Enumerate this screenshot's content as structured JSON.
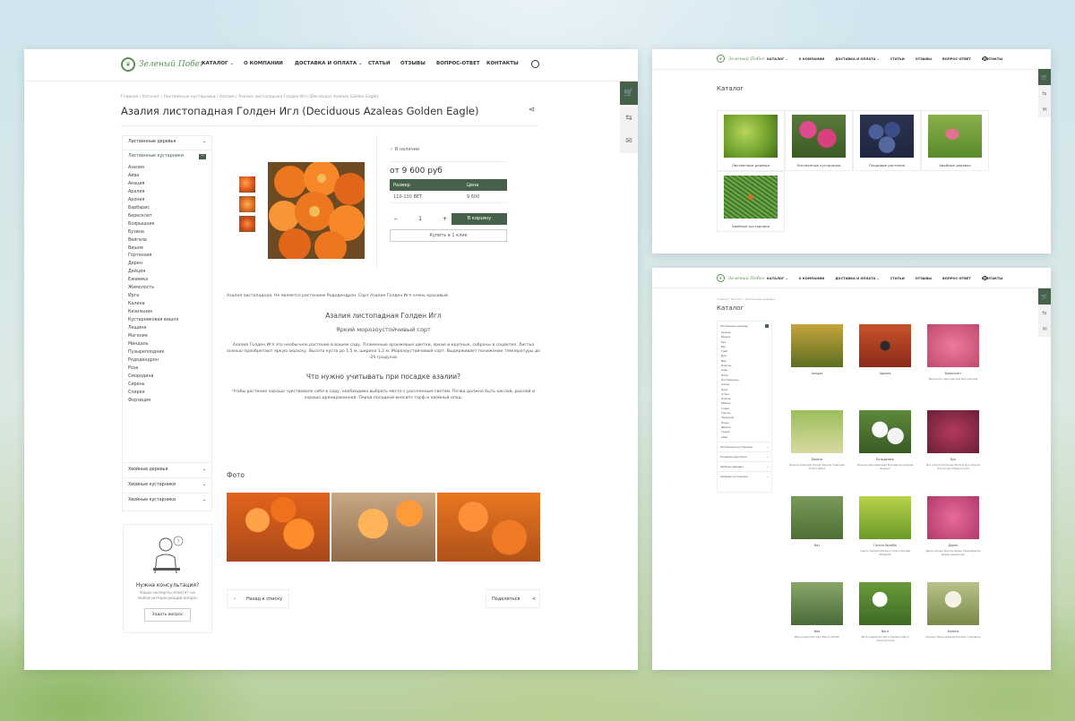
{
  "logo_text": "Зеленый Побег",
  "main": {
    "nav": [
      {
        "label": "КАТАЛОГ",
        "caret": "⌄"
      },
      {
        "label": "О КОМПАНИИ"
      },
      {
        "label": "ДОСТАВКА И ОПЛАТА",
        "caret": "⌄"
      },
      {
        "label": "СТАТЬИ"
      },
      {
        "label": "ОТЗЫВЫ"
      },
      {
        "label": "ВОПРОС-ОТВЕТ"
      },
      {
        "label": "КОНТАКТЫ"
      }
    ],
    "breadcrumb": "Главная  /  Каталог  /  Лиственные кустарники  /  Азалия  /  Азалия листопадная Голден Игл (Deciduous Azaleas Golden Eagle)",
    "title": "Азалия листопадная Голден Игл (Deciduous Azaleas Golden Eagle)",
    "sidebar": {
      "groups": [
        {
          "label": "Лиственные деревья"
        },
        {
          "label": "Лиственные кустарники"
        }
      ],
      "items": [
        "Азалия",
        "Айва",
        "Акация",
        "Аралия",
        "Арония",
        "Барбарис",
        "Бересклет",
        "Боярышник",
        "Бузина",
        "Вейгела",
        "Вишня",
        "Гортензия",
        "Дерен",
        "Дейция",
        "Ежевика",
        "Жимолость",
        "Ирга",
        "Калина",
        "Кизильник",
        "Кустарниковая вишня",
        "Лещина",
        "Магония",
        "Миндаль",
        "Пузыреплодник",
        "Рододендрон",
        "Роза",
        "Смородина",
        "Сирень",
        "Спирея",
        "Форзиция"
      ],
      "bottom_groups": [
        "Хвойные деревья",
        "Хвойные кустарники",
        "Хвойные кустарники"
      ],
      "consult_title": "Нужна консультация?",
      "consult_text": "Наши эксперты ответят на любой интересующий вопрос",
      "consult_button": "Задать вопрос"
    },
    "product": {
      "availability": "В наличии",
      "price": "от 9 600 руб",
      "table_headers": [
        "Размер",
        "Цена"
      ],
      "table_row": [
        "110-130 ВЕТ.",
        "9 600"
      ],
      "qty": "1",
      "cart_button": "В корзину",
      "oneclick_button": "Купить в 1 клик",
      "intro": "Азалия листопадная. Не является растением Рододендрон. Сорт Азалия Голден Игл очень красивый.",
      "heading": "Азалия листопадная Голден Игл",
      "subheading": "Яркий морозоустойчивый сорт",
      "desc": "Азалия Голден Игл это необычное растение в вашем саду. Пламенные оранжевые цветки, яркие и крупные, собраны в соцветия. Листья осенью приобретают яркую окраску. Высота куста до 1,5 м, ширина 1,2 м. Морозоустойчивый сорт. Выдерживает понижение температуры до -29 градусов.",
      "question": "Что нужно учитывать при посадке азалии?",
      "question_text": "Чтобы растение хорошо чувствовало себя в саду, необходимо выбрать место с рассеянным светом. Почва должна быть кислой, рыхлой и хорошо дренированной. Перед посадкой внесите торф и хвойный опад.",
      "photos_title": "Фото",
      "back_button": "Назад к списку",
      "share_button": "Поделиться"
    }
  },
  "catalog_top": {
    "nav": [
      "КАТАЛОГ",
      "О КОМПАНИИ",
      "ДОСТАВКА И ОПЛАТА",
      "СТАТЬИ",
      "ОТЗЫВЫ",
      "ВОПРОС-ОТВЕТ",
      "КОНТАКТЫ"
    ],
    "title": "Каталог",
    "tiles": [
      {
        "label": "Лиственные деревья"
      },
      {
        "label": "Лиственные кустарники"
      },
      {
        "label": "Плодовые растения"
      },
      {
        "label": "Хвойные деревья"
      },
      {
        "label": "Хвойные кустарники"
      }
    ]
  },
  "catalog_bottom": {
    "nav": [
      "КАТАЛОГ",
      "О КОМПАНИИ",
      "ДОСТАВКА И ОПЛАТА",
      "СТАТЬИ",
      "ОТЗЫВЫ",
      "ВОПРОС-ОТВЕТ",
      "КОНТАКТЫ"
    ],
    "breadcrumb": "Главная  /  Каталог  /  Лиственные деревья",
    "title": "Каталог",
    "sidebar_groups": [
      "Лиственные деревья",
      "Лиственные кустарники",
      "Плодовые растения",
      "Хвойные деревья",
      "Хвойные кустарники"
    ],
    "sidebar_items": [
      "Акация",
      "Береза",
      "Бук",
      "Вяз",
      "Граб",
      "Дуб",
      "Ива",
      "Каштан",
      "Клен",
      "Липа",
      "Лиственница",
      "Ольха",
      "Орех",
      "Осина",
      "Платан",
      "Рябина",
      "Слива",
      "Тополь",
      "Черемуха",
      "Ясень",
      "Яблоня",
      "Груша",
      "Айва"
    ],
    "tiles": [
      {
        "label": "Акация",
        "desc": ""
      },
      {
        "label": "Арония",
        "desc": ""
      },
      {
        "label": "Бересклет",
        "desc": "Бересклет европейский Red Cascade"
      },
      {
        "label": "Береза",
        "desc": "Береза повислая Youngii Береза повислая Trost's Dwarf"
      },
      {
        "label": "Бульденеж",
        "desc": "Калина обыкновенная Бульденеж Калина Roseum"
      },
      {
        "label": "Бук",
        "desc": "Бук лесной Purpurea Pendula Бук лесной Tricolor Бук Dawyck Gold"
      },
      {
        "label": "Вяз",
        "desc": ""
      },
      {
        "label": "Гинкго билоба",
        "desc": "Гинкго билоба Mariken Гинкго билоба Fastigiata"
      },
      {
        "label": "Дерен",
        "desc": "Дерен белый Sibirica Дерен Elegantissima Дерен Kesselringii"
      },
      {
        "label": "Ива",
        "desc": "Ива цельнолистная Hakuro Nishiki"
      },
      {
        "label": "Ирга",
        "desc": "Ирга канадская Ирга Ламарка Ирга ольхолистная"
      },
      {
        "label": "Калина",
        "desc": "Калина обыкновенная Калина гордовина"
      }
    ]
  }
}
